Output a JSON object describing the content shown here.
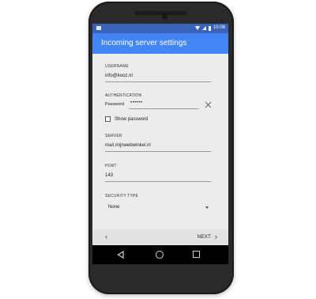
{
  "status_bar": {
    "time": "10:08"
  },
  "app_bar": {
    "title": "Incoming server settings"
  },
  "form": {
    "username": {
      "label": "USERNAME",
      "value": "info@kooz.nl"
    },
    "authentication": {
      "label": "AUTHENTICATION",
      "password_label": "Password",
      "password_value": "••••••",
      "show_password_label": "Show password",
      "show_password_checked": false
    },
    "server": {
      "label": "SERVER",
      "value": "mail.mijnwebwinkel.nl"
    },
    "port": {
      "label": "PORT",
      "value": "143"
    },
    "security_type": {
      "label": "SECURITY TYPE",
      "value": "None"
    }
  },
  "bottom_bar": {
    "back_label": "‹",
    "next_label": "NEXT",
    "next_chevron": "›"
  },
  "colors": {
    "app_bar": "#4285f4",
    "status_bar": "#3a62b8",
    "screen_bg": "#ececec"
  }
}
